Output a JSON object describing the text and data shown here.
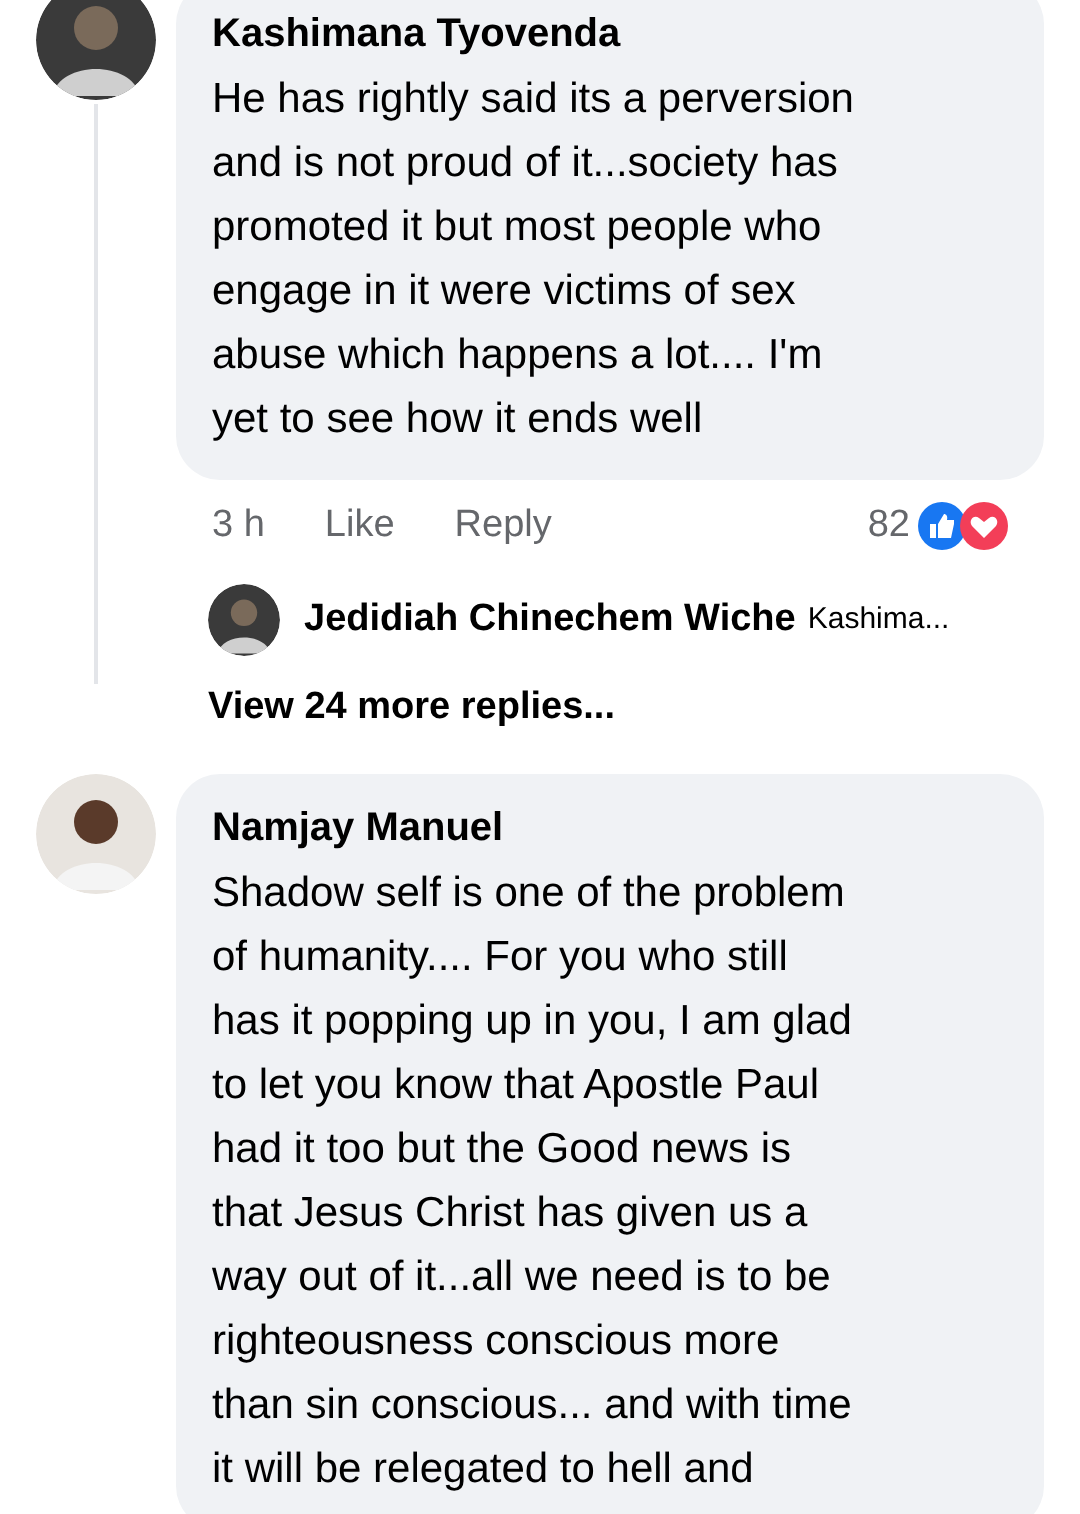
{
  "comments": [
    {
      "author": "Kashimana Tyovenda",
      "body_lines": [
        "He has rightly said its a perversion",
        "and is not proud of it...society has",
        "promoted it but most people who",
        "engage in it were victims of sex",
        "abuse which happens a lot.... I'm",
        "yet to see how it ends well"
      ],
      "time": "3 h",
      "like": "Like",
      "reply": "Reply",
      "reaction_count": "82",
      "reply_preview": {
        "author": "Jedidiah Chinechem Wiche",
        "text": "Kashima..."
      },
      "more_replies": "View 24 more replies..."
    },
    {
      "author": "Namjay Manuel",
      "body_lines": [
        "Shadow self is one of the problem",
        "of humanity.... For you who still",
        "has it popping up in you, I am glad",
        "to let you know that  Apostle Paul",
        "had it too but the Good news is",
        "that Jesus Christ has given us a",
        "way out of it...all we need is to be",
        "righteousness conscious more",
        "than sin conscious... and with time",
        "it will be relegated to hell and"
      ]
    }
  ]
}
